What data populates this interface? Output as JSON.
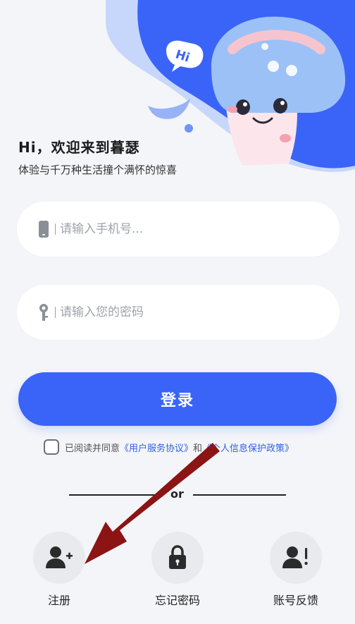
{
  "hero": {
    "bubble_text": "Hi"
  },
  "greeting": "Hi，欢迎来到暮瑟",
  "subtitle": "体验与千万种生活撞个满怀的惊喜",
  "phone_field": {
    "placeholder": "请输入手机号...",
    "icon": "phone-icon"
  },
  "password_field": {
    "placeholder": "请输入您的密码",
    "icon": "key-icon"
  },
  "login_button": "登录",
  "agreement": {
    "prefix": "已阅读并同意",
    "user_agreement": "《用户服务协议》",
    "and": "和",
    "privacy_policy": "《个人信息保护政策》"
  },
  "divider_text": "or",
  "actions": [
    {
      "label": "注册",
      "icon": "add-user-icon"
    },
    {
      "label": "忘记密码",
      "icon": "lock-icon"
    },
    {
      "label": "账号反馈",
      "icon": "user-alert-icon"
    }
  ],
  "colors": {
    "accent": "#3a64f7",
    "link": "#2f5fe8",
    "background": "#f4f5f9",
    "arrow": "#8b1414"
  }
}
